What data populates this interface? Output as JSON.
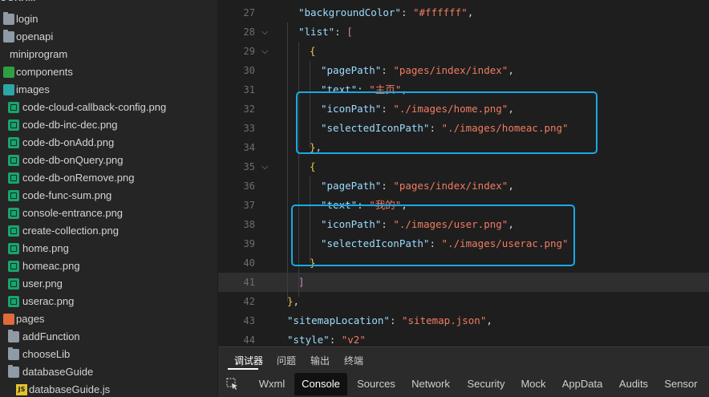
{
  "sidebar": {
    "section_title": "OGRAM",
    "items": [
      {
        "label": "login",
        "icon": "folder-icon"
      },
      {
        "label": "openapi",
        "icon": "folder-icon"
      },
      {
        "label": "miniprogram",
        "icon": "folder-icon"
      },
      {
        "label": "components",
        "icon": "components-folder-icon"
      },
      {
        "label": "images",
        "icon": "images-folder-icon"
      },
      {
        "label": "code-cloud-callback-config.png",
        "icon": "image-file-icon"
      },
      {
        "label": "code-db-inc-dec.png",
        "icon": "image-file-icon"
      },
      {
        "label": "code-db-onAdd.png",
        "icon": "image-file-icon"
      },
      {
        "label": "code-db-onQuery.png",
        "icon": "image-file-icon"
      },
      {
        "label": "code-db-onRemove.png",
        "icon": "image-file-icon"
      },
      {
        "label": "code-func-sum.png",
        "icon": "image-file-icon"
      },
      {
        "label": "console-entrance.png",
        "icon": "image-file-icon"
      },
      {
        "label": "create-collection.png",
        "icon": "image-file-icon"
      },
      {
        "label": "home.png",
        "icon": "image-file-icon"
      },
      {
        "label": "homeac.png",
        "icon": "image-file-icon"
      },
      {
        "label": "user.png",
        "icon": "image-file-icon"
      },
      {
        "label": "userac.png",
        "icon": "image-file-icon"
      },
      {
        "label": "pages",
        "icon": "pages-folder-icon"
      },
      {
        "label": "addFunction",
        "icon": "folder-icon"
      },
      {
        "label": "chooseLib",
        "icon": "folder-icon"
      },
      {
        "label": "databaseGuide",
        "icon": "folder-icon"
      },
      {
        "label": "databaseGuide.js",
        "icon": "js-file-icon"
      }
    ]
  },
  "editor": {
    "lines": [
      {
        "n": "27",
        "fold": "",
        "tokens": [
          {
            "t": "\"backgroundColor\"",
            "c": "k"
          },
          {
            "t": ": ",
            "c": "p"
          },
          {
            "t": "\"#ffffff\"",
            "c": "s"
          },
          {
            "t": ",",
            "c": "p"
          }
        ]
      },
      {
        "n": "28",
        "fold": "⌵",
        "tokens": [
          {
            "t": "\"list\"",
            "c": "k"
          },
          {
            "t": ": ",
            "c": "p"
          },
          {
            "t": "[",
            "c": "bd"
          }
        ]
      },
      {
        "n": "29",
        "fold": "⌵",
        "tokens": [
          {
            "t": "{",
            "c": "b"
          }
        ]
      },
      {
        "n": "30",
        "fold": "",
        "tokens": [
          {
            "t": "\"pagePath\"",
            "c": "k"
          },
          {
            "t": ": ",
            "c": "p"
          },
          {
            "t": "\"pages/index/index\"",
            "c": "s"
          },
          {
            "t": ",",
            "c": "p"
          }
        ]
      },
      {
        "n": "31",
        "fold": "",
        "tokens": [
          {
            "t": "\"text\"",
            "c": "k"
          },
          {
            "t": ": ",
            "c": "p"
          },
          {
            "t": "\"主页\"",
            "c": "s"
          },
          {
            "t": ",",
            "c": "p"
          }
        ]
      },
      {
        "n": "32",
        "fold": "",
        "tokens": [
          {
            "t": "\"iconPath\"",
            "c": "k"
          },
          {
            "t": ": ",
            "c": "p"
          },
          {
            "t": "\"./images/home.png\"",
            "c": "s"
          },
          {
            "t": ",",
            "c": "p"
          }
        ]
      },
      {
        "n": "33",
        "fold": "",
        "tokens": [
          {
            "t": "\"selectedIconPath\"",
            "c": "k"
          },
          {
            "t": ": ",
            "c": "p"
          },
          {
            "t": "\"./images/homeac.png\"",
            "c": "s"
          }
        ]
      },
      {
        "n": "34",
        "fold": "",
        "tokens": [
          {
            "t": "}",
            "c": "b"
          },
          {
            "t": ",",
            "c": "p"
          }
        ]
      },
      {
        "n": "35",
        "fold": "⌵",
        "tokens": [
          {
            "t": "{",
            "c": "b"
          }
        ]
      },
      {
        "n": "36",
        "fold": "",
        "tokens": [
          {
            "t": "\"pagePath\"",
            "c": "k"
          },
          {
            "t": ": ",
            "c": "p"
          },
          {
            "t": "\"pages/index/index\"",
            "c": "s"
          },
          {
            "t": ",",
            "c": "p"
          }
        ]
      },
      {
        "n": "37",
        "fold": "",
        "tokens": [
          {
            "t": "\"text\"",
            "c": "k"
          },
          {
            "t": ": ",
            "c": "p"
          },
          {
            "t": "\"我的\"",
            "c": "s"
          },
          {
            "t": ",",
            "c": "p"
          }
        ]
      },
      {
        "n": "38",
        "fold": "",
        "tokens": [
          {
            "t": "\"iconPath\"",
            "c": "k"
          },
          {
            "t": ": ",
            "c": "p"
          },
          {
            "t": "\"./images/user.png\"",
            "c": "s"
          },
          {
            "t": ",",
            "c": "p"
          }
        ]
      },
      {
        "n": "39",
        "fold": "",
        "tokens": [
          {
            "t": "\"selectedIconPath\"",
            "c": "k"
          },
          {
            "t": ": ",
            "c": "p"
          },
          {
            "t": "\"./images/userac.png\"",
            "c": "s"
          }
        ]
      },
      {
        "n": "40",
        "fold": "",
        "tokens": [
          {
            "t": "}",
            "c": "b"
          }
        ]
      },
      {
        "n": "41",
        "fold": "",
        "tokens": [
          {
            "t": "]",
            "c": "bd"
          }
        ]
      },
      {
        "n": "42",
        "fold": "",
        "tokens": [
          {
            "t": "}",
            "c": "b"
          },
          {
            "t": ",",
            "c": "p"
          }
        ]
      },
      {
        "n": "43",
        "fold": "",
        "tokens": [
          {
            "t": "\"sitemapLocation\"",
            "c": "k"
          },
          {
            "t": ": ",
            "c": "p"
          },
          {
            "t": "\"sitemap.json\"",
            "c": "s"
          },
          {
            "t": ",",
            "c": "p"
          }
        ]
      },
      {
        "n": "44",
        "fold": "",
        "tokens": [
          {
            "t": "\"style\"",
            "c": "k"
          },
          {
            "t": ": ",
            "c": "p"
          },
          {
            "t": "\"v2\"",
            "c": "s"
          }
        ]
      }
    ]
  },
  "devtools": {
    "top_tabs": [
      {
        "label": "调试器",
        "active": true
      },
      {
        "label": "问题",
        "active": false
      },
      {
        "label": "输出",
        "active": false
      },
      {
        "label": "终端",
        "active": false
      }
    ],
    "panel_tabs": [
      {
        "label": "Wxml",
        "active": false
      },
      {
        "label": "Console",
        "active": true
      },
      {
        "label": "Sources",
        "active": false
      },
      {
        "label": "Network",
        "active": false
      },
      {
        "label": "Security",
        "active": false
      },
      {
        "label": "Mock",
        "active": false
      },
      {
        "label": "AppData",
        "active": false
      },
      {
        "label": "Audits",
        "active": false
      },
      {
        "label": "Sensor",
        "active": false
      }
    ],
    "inspect_icon": "inspect-cursor-icon"
  },
  "colors": {
    "highlight_box": "#19a9e6",
    "string": "#f07c62",
    "key": "#9cdcfe"
  }
}
